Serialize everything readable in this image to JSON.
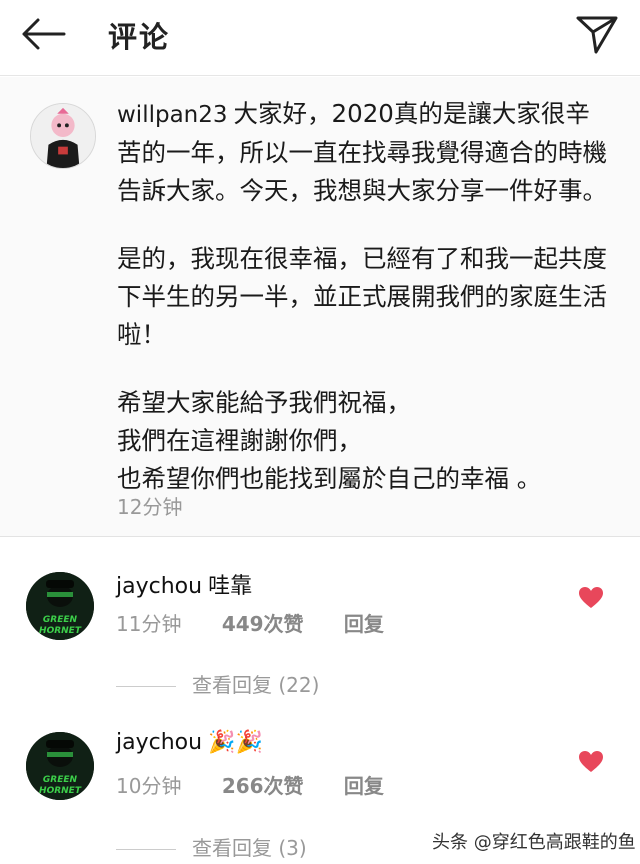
{
  "header": {
    "title": "评论"
  },
  "post": {
    "username": "willpan23",
    "paragraphs": [
      "大家好，2020真的是讓大家很辛苦的一年，所以一直在找尋我覺得適合的時機告訴大家。今天，我想與大家分享一件好事。",
      "是的，我现在很幸福，已經有了和我一起共度下半生的另一半，並正式展開我們的家庭生活啦！",
      "希望大家能給予我們祝福，",
      "我們在這裡謝謝你們，",
      "也希望你們也能找到屬於自己的幸福 。"
    ],
    "time": "12分钟"
  },
  "comments": [
    {
      "username": "jaychou",
      "text": "哇靠",
      "time": "11分钟",
      "likes": "449次赞",
      "reply": "回复",
      "view_replies": "查看回复 (22)",
      "avatar_text": "GREEN HORNET"
    },
    {
      "username": "jaychou",
      "text": "🎉🎉",
      "time": "10分钟",
      "likes": "266次赞",
      "reply": "回复",
      "view_replies": "查看回复 (3)",
      "avatar_text": "GREEN HORNET"
    }
  ],
  "watermark": "头条 @穿红色高跟鞋的鱼",
  "colors": {
    "heart": "#e8475b",
    "muted": "#999999",
    "background": "#fafafa"
  }
}
